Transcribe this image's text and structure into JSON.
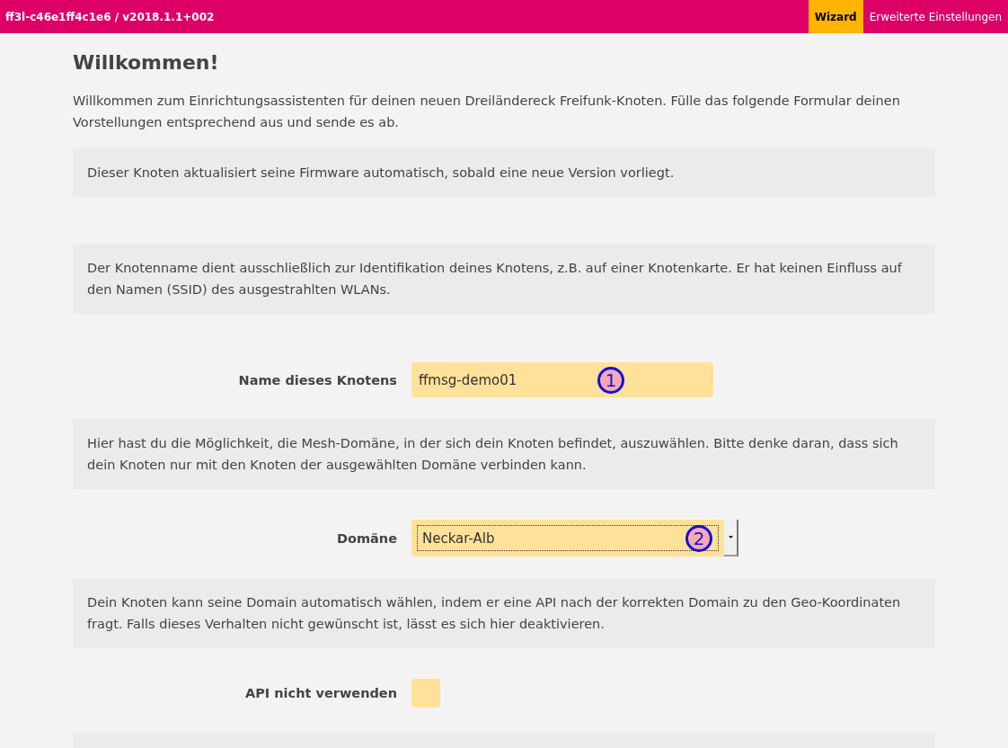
{
  "header": {
    "title": "ff3l-c46e1ff4c1e6 / v2018.1.1+002",
    "tabs": [
      {
        "label": "Wizard",
        "selected": true
      },
      {
        "label": "Erweiterte Einstellungen",
        "selected": false
      }
    ]
  },
  "heading": "Willkommen!",
  "intro": "Willkommen zum Einrichtungsassistenten für deinen neuen Dreiländereck Freifunk-Knoten. Fülle das folgende Formular deinen Vorstellungen entsprechend aus und sende es ab.",
  "sections": [
    {
      "kind": "note",
      "text": "Dieser Knoten aktualisiert seine Firmware automatisch, sobald eine neue Version vorliegt."
    },
    {
      "kind": "spacer"
    },
    {
      "kind": "note",
      "text": "Der Knotenname dient ausschließlich zur Identifikation deines Knotens, z.B. auf einer Knotenkarte. Er hat keinen Einfluss auf den Namen (SSID) des ausgestrahlten WLANs."
    },
    {
      "kind": "text",
      "label": "Name dieses Knotens",
      "value": "ffmsg-demo01",
      "callout": "1"
    },
    {
      "kind": "note",
      "text": "Hier hast du die Möglichkeit, die Mesh-Domäne, in der sich dein Knoten befindet, auszuwählen. Bitte denke daran, dass sich dein Knoten nur mit den Knoten der ausgewählten Domäne verbinden kann."
    },
    {
      "kind": "select",
      "label": "Domäne",
      "value": "Neckar-Alb",
      "callout": "2"
    },
    {
      "kind": "note",
      "text": "Dein Knoten kann seine Domain automatisch wählen, indem er eine API nach der korrekten Domain zu den Geo-Koordinaten fragt. Falls dieses Verhalten nicht gewünscht ist, lässt es sich hier deaktivieren."
    },
    {
      "kind": "checkbox",
      "label": "API nicht verwenden",
      "checked": false
    },
    {
      "kind": "note"
    }
  ]
}
